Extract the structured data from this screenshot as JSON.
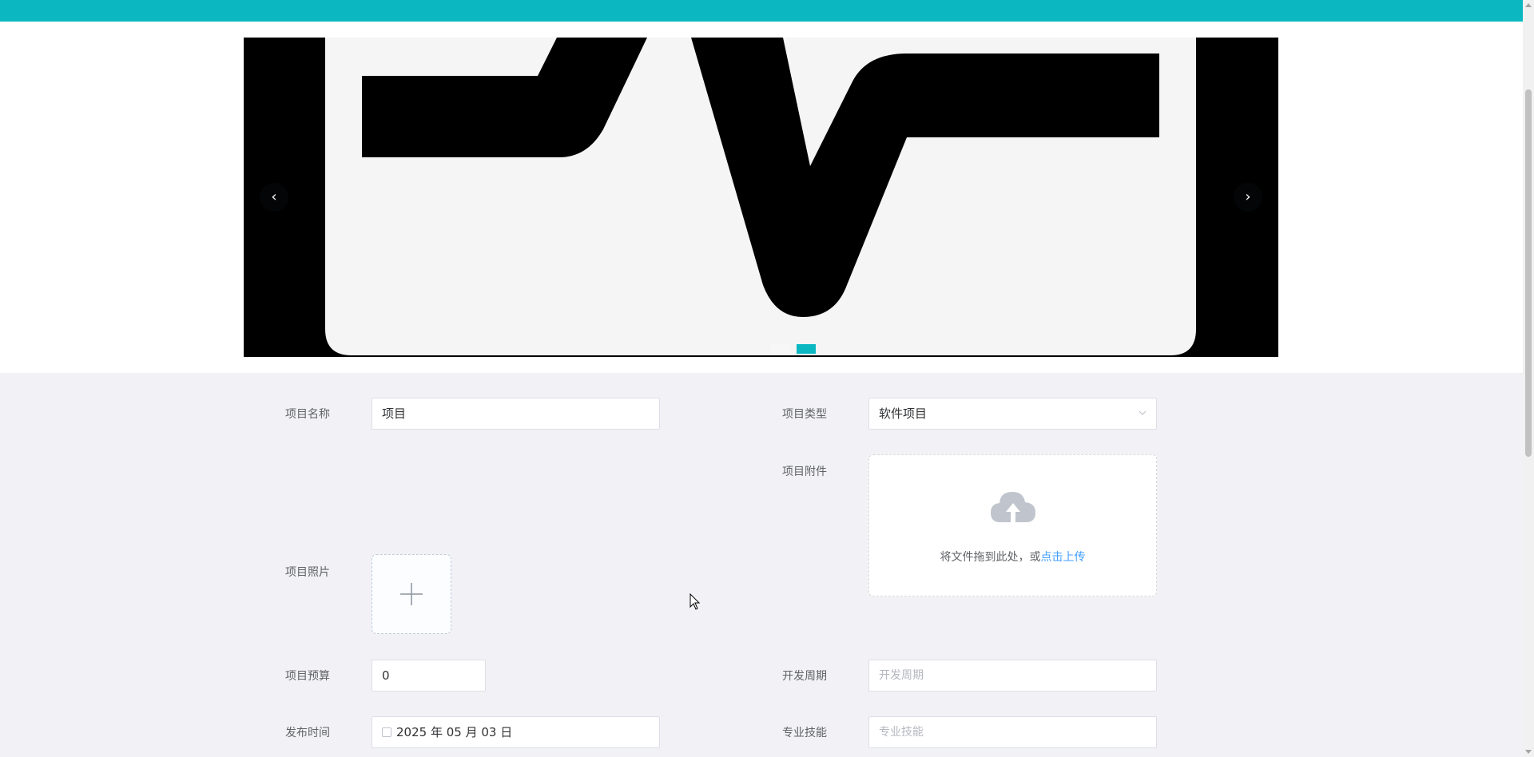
{
  "theme": {
    "accent": "#0bb8c2",
    "link": "#409eff",
    "form_bg": "#f2f2f6"
  },
  "carousel": {
    "prev_icon": "chevron-left-icon",
    "next_icon": "chevron-right-icon",
    "prev_glyph": "‹",
    "next_glyph": "›",
    "slide_count": 2,
    "active_index": 1
  },
  "form": {
    "name": {
      "label": "项目名称",
      "value": "项目"
    },
    "type": {
      "label": "项目类型",
      "value": "软件项目"
    },
    "attachment": {
      "label": "项目附件",
      "hint": "将文件拖到此处，或",
      "link": "点击上传"
    },
    "photo": {
      "label": "项目照片"
    },
    "budget": {
      "label": "项目预算",
      "value": "0"
    },
    "cycle": {
      "label": "开发周期",
      "placeholder": "开发周期"
    },
    "publish": {
      "label": "发布时间",
      "value": "2025 年 05 月 03 日"
    },
    "skills": {
      "label": "专业技能",
      "placeholder": "专业技能"
    }
  }
}
